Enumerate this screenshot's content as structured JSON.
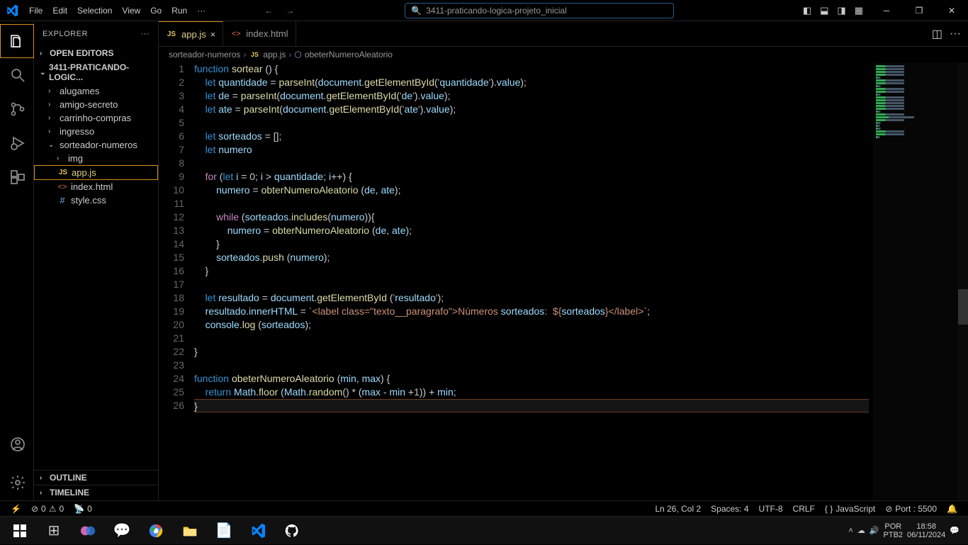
{
  "menu": {
    "file": "File",
    "edit": "Edit",
    "selection": "Selection",
    "view": "View",
    "go": "Go",
    "run": "Run",
    "more": "···"
  },
  "search_text": "3411-praticando-logica-projeto_inicial",
  "sidebar": {
    "title": "EXPLORER",
    "open_editors": "OPEN EDITORS",
    "project": "3411-PRATICANDO-LOGIC...",
    "folders": [
      "alugames",
      "amigo-secreto",
      "carrinho-compras",
      "ingresso",
      "sorteador-numeros"
    ],
    "subfolder": "img",
    "files": [
      "app.js",
      "index.html",
      "style.css"
    ],
    "outline": "OUTLINE",
    "timeline": "TIMELINE"
  },
  "tabs": {
    "t1": "app.js",
    "t2": "index.html"
  },
  "breadcrumb": {
    "p1": "sorteador-numeros",
    "p2": "app.js",
    "p3": "obeterNumeroAleatorio"
  },
  "status": {
    "errors": "0",
    "warnings": "0",
    "port_zero": "0",
    "pos": "Ln 26, Col 2",
    "spaces": "Spaces: 4",
    "enc": "UTF-8",
    "eol": "CRLF",
    "lang": "JavaScript",
    "port": "Port : 5500"
  },
  "tray": {
    "lang1": "POR",
    "lang2": "PTB2",
    "time": "18:58",
    "date": "06/11/2024"
  },
  "code": {
    "lines": [
      "function sortear () {",
      "    let quantidade = parseInt(document.getElementById('quantidade').value);",
      "    let de = parseInt(document.getElementById('de').value);",
      "    let ate = parseInt(document.getElementById('ate').value);",
      "",
      "    let sorteados = [];",
      "    let numero",
      "",
      "    for (let i = 0; i > quantidade; i++) {",
      "        numero = obterNumeroAleatorio (de, ate);",
      "",
      "        while (sorteados.includes(numero)){",
      "            numero = obterNumeroAleatorio (de, ate);",
      "        }",
      "        sorteados.push (numero);",
      "    }",
      "",
      "    let resultado = document.getElementById ('resultado');",
      "    resultado.innerHTML = `<label class=\"texto__paragrafo\">Números sorteados:  ${sorteados}</label>`;",
      "    console.log (sorteados);",
      "",
      "}",
      "",
      "function obeterNumeroAleatorio (min, max) {",
      "    return Math.floor (Math.random() * (max - min +1)) + min;",
      "}"
    ]
  }
}
